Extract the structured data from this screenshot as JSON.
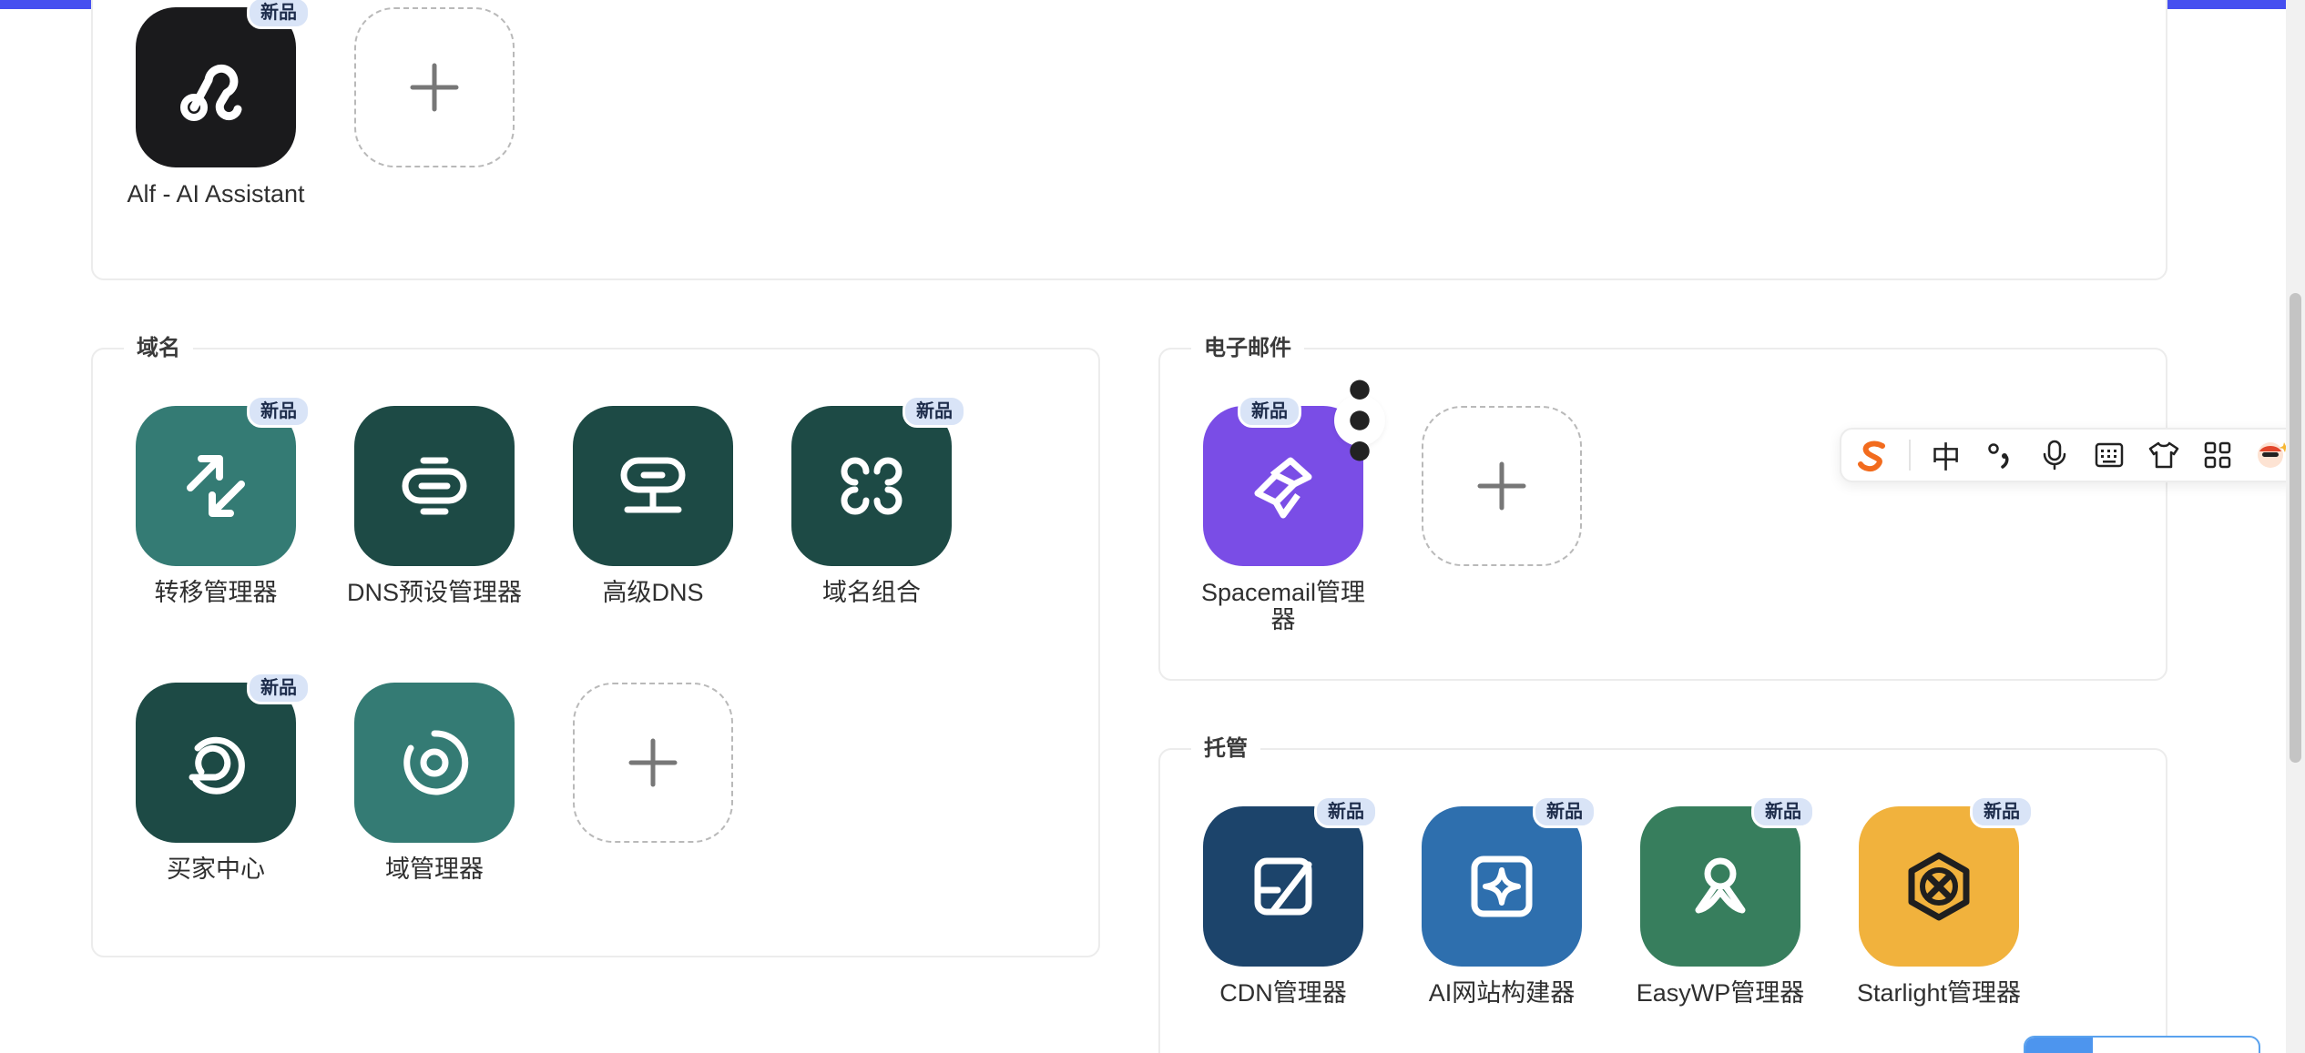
{
  "colors": {
    "top_bar": "#4650f0",
    "domain_teal": "#347b74",
    "domain_dark": "#1d4a45",
    "spacemail": "#7a4de6",
    "cdn": "#1c446b",
    "ai_builder": "#2e6fae",
    "easywp": "#377e5d",
    "starlight": "#f1b23d",
    "alf": "#1a1a1c",
    "badge_bg": "#d9e4f7"
  },
  "top_section": {
    "apps": [
      {
        "label": "Alf - AI Assistant",
        "badge": "新品",
        "icon": "alf-icon"
      }
    ]
  },
  "domain_section": {
    "title": "域名",
    "apps": [
      {
        "label": "转移管理器",
        "badge": "新品",
        "icon": "transfer-arrows-icon"
      },
      {
        "label": "DNS预设管理器",
        "badge": "",
        "icon": "dns-preset-icon"
      },
      {
        "label": "高级DNS",
        "badge": "",
        "icon": "advanced-dns-icon"
      },
      {
        "label": "域名组合",
        "badge": "新品",
        "icon": "domain-portfolio-icon"
      },
      {
        "label": "买家中心",
        "badge": "新品",
        "icon": "buyer-center-icon"
      },
      {
        "label": "域管理器",
        "badge": "",
        "icon": "domain-manager-icon"
      }
    ]
  },
  "email_section": {
    "title": "电子邮件",
    "apps": [
      {
        "label": "Spacemail管理器",
        "badge": "新品",
        "icon": "spacemail-icon"
      }
    ]
  },
  "hosting_section": {
    "title": "托管",
    "apps": [
      {
        "label": "CDN管理器",
        "badge": "新品",
        "icon": "cdn-icon"
      },
      {
        "label": "AI网站构建器",
        "badge": "新品",
        "icon": "ai-site-builder-icon"
      },
      {
        "label": "EasyWP管理器",
        "badge": "新品",
        "icon": "easywp-icon"
      },
      {
        "label": "Starlight管理器",
        "badge": "新品",
        "icon": "starlight-icon"
      }
    ]
  },
  "ime_toolbar": {
    "chinese_mode": "中",
    "items": [
      "sogou-logo-icon",
      "punctuation-icon",
      "microphone-icon",
      "keyboard-icon",
      "skin-shirt-icon",
      "toolbox-grid-icon",
      "avatar-icon"
    ]
  }
}
